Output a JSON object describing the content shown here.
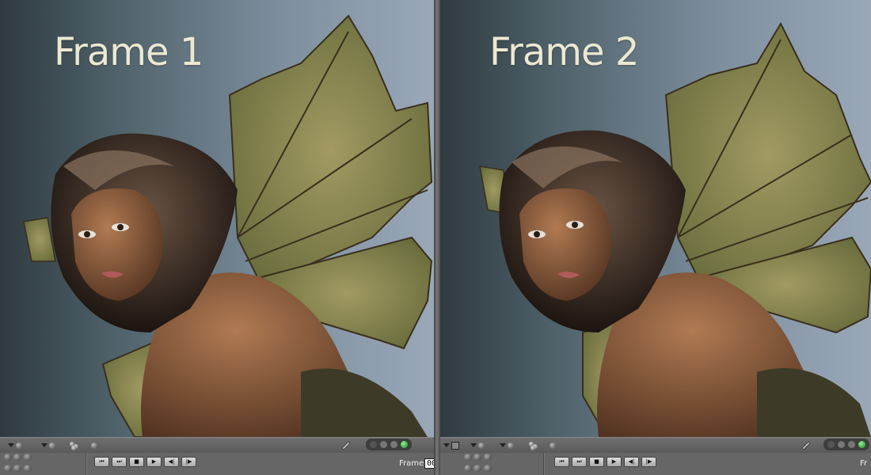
{
  "panes": [
    {
      "frame_label": "Frame 1",
      "frame_readout_label": "Frame:",
      "frame_value": "000",
      "transport": [
        "⏮",
        "⏭",
        "■",
        "▶",
        "◀|",
        "|▶"
      ]
    },
    {
      "frame_label": "Frame 2",
      "frame_readout_label": "Fr",
      "frame_value": "",
      "transport": [
        "⏮",
        "⏭",
        "■",
        "▶",
        "◀|",
        "|▶"
      ]
    }
  ],
  "icons": {
    "camera_grid": "camera-grid-icon",
    "pencil": "pencil-icon",
    "render_lights": "render-status-lights"
  },
  "colors": {
    "background_sky": "#7d8f9e",
    "wing": "#8a8a52",
    "skin": "#8a5a3c",
    "ui_gray": "#666666",
    "status_green": "#2fae2f"
  }
}
